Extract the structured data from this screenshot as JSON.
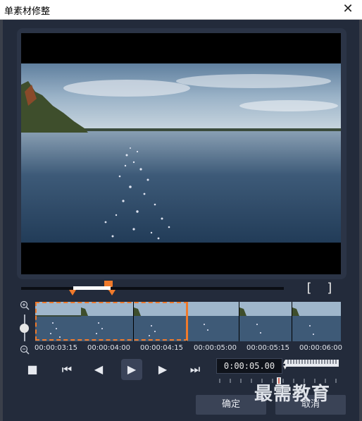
{
  "window": {
    "title": "单素材修整",
    "close_label": "✕"
  },
  "trim": {
    "bracket_in": "[",
    "bracket_out": "]"
  },
  "zoom": {
    "zoom_in_icon": "zoom-in-icon",
    "zoom_out_icon": "zoom-out-icon"
  },
  "timecodes": [
    "00:00:03:15",
    "00:00:04:00",
    "00:00:04:15",
    "00:00:05:00",
    "00:00:05:15",
    "00:00:06:00"
  ],
  "transport": {
    "stop_icon": "■",
    "to_start_icon": "⏮",
    "prev_frame_icon": "◀",
    "play_icon": "▶",
    "next_frame_icon": "▶",
    "to_end_icon": "⏭"
  },
  "timecode_field": {
    "value": "0:00:05.00"
  },
  "buttons": {
    "ok": "确定",
    "cancel": "取消"
  },
  "watermark": "最需教育",
  "colors": {
    "accent": "#f07a2b",
    "background": "#232b3b"
  }
}
